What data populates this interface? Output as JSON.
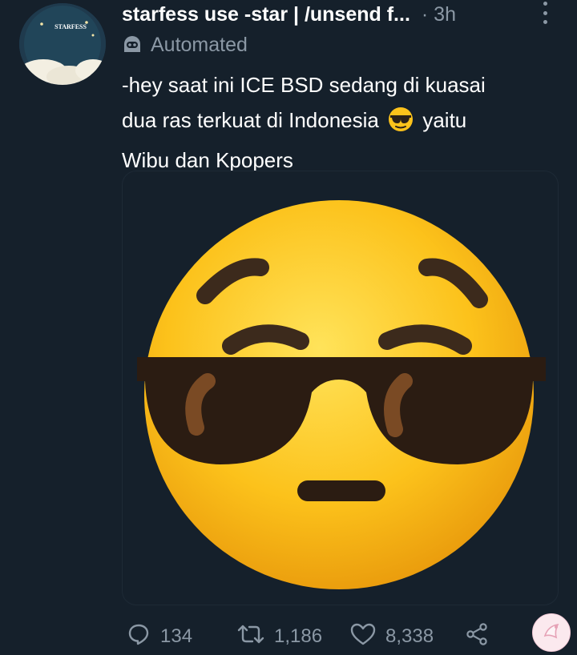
{
  "tweet": {
    "author_name": "starfess use -star | /unsend f...",
    "time": "· 3h",
    "automated_label": "Automated",
    "text_line1": "-hey saat ini ICE BSD sedang di kuasai",
    "text_line2_a": "dua ras terkuat di Indonesia",
    "text_line2_b": "yaitu",
    "text_line3": "Wibu dan Kpopers",
    "avatar_text": "STARFESS"
  },
  "actions": {
    "replies": "134",
    "retweets": "1,186",
    "likes": "8,338"
  },
  "icons": {
    "more": "more-vertical-icon",
    "bot": "bot-icon",
    "reply": "reply-icon",
    "retweet": "retweet-icon",
    "like": "heart-icon",
    "share": "share-icon"
  },
  "colors": {
    "background": "#15202b",
    "secondary_text": "#8b98a5",
    "emoji_yellow": "#fcc21b"
  }
}
